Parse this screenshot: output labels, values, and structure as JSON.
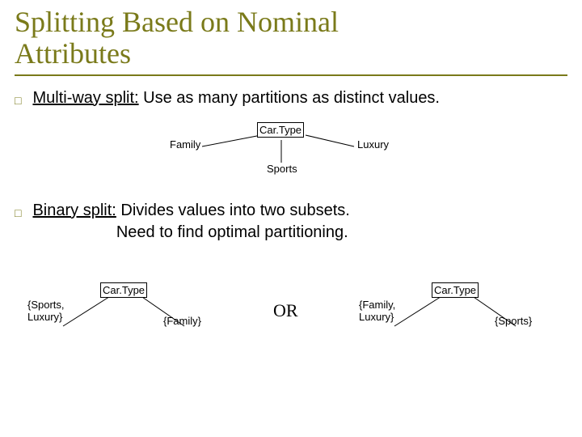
{
  "title_line1": "Splitting Based on Nominal",
  "title_line2": "Attributes",
  "bullet1_attr": "Multi-way split:",
  "bullet1_rest": " Use as many partitions as distinct values.",
  "multiway": {
    "node": "Car.Type",
    "left": "Family",
    "mid": "Sports",
    "right": "Luxury"
  },
  "bullet2_attr": "Binary split:",
  "bullet2_rest_a": "  Divides values into two subsets.",
  "bullet2_rest_b": "Need to find optimal partitioning.",
  "binaryA": {
    "node": "Car.Type",
    "left": "{Sports,\nLuxury}",
    "right": "{Family}"
  },
  "or_label": "OR",
  "binaryB": {
    "node": "Car.Type",
    "left": "{Family,\nLuxury}",
    "right": "{Sports}"
  }
}
